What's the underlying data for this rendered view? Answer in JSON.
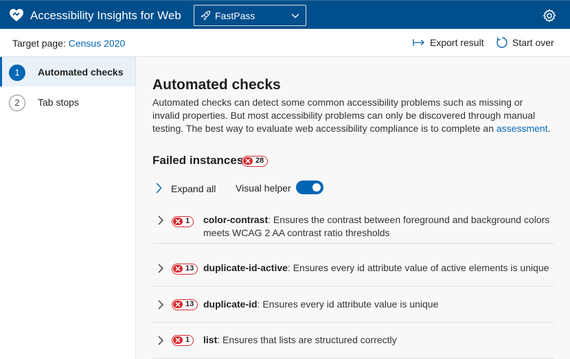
{
  "app": {
    "title": "Accessibility Insights for Web",
    "mode_selected": "FastPass",
    "brand_icon": "heart-icon",
    "settings_icon": "gear-icon"
  },
  "command_bar": {
    "target_label": "Target page: ",
    "target_link": "Census 2020",
    "export_label": "Export result",
    "start_over_label": "Start over"
  },
  "left_nav": {
    "items": [
      {
        "number": "1",
        "label": "Automated checks",
        "active": true
      },
      {
        "number": "2",
        "label": "Tab stops",
        "active": false
      }
    ]
  },
  "main": {
    "heading": "Automated checks",
    "description": "Automated checks can detect some common accessibility problems such as missing or invalid properties. But most accessibility problems can only be discovered through manual testing. The best way to evaluate web accessibility compliance is to complete an ",
    "description_link": "assessment",
    "description_end": ".",
    "failed_heading": "Failed instances",
    "failed_count": "28",
    "expand_all_label": "Expand all",
    "visual_helper_label": "Visual helper",
    "visual_helper_on": true,
    "rules": [
      {
        "count": "1",
        "id": "color-contrast",
        "description": ": Ensures the contrast between foreground and background colors meets WCAG 2 AA contrast ratio thresholds"
      },
      {
        "count": "13",
        "id": "duplicate-id-active",
        "description": ": Ensures every id attribute value of active elements is unique"
      },
      {
        "count": "13",
        "id": "duplicate-id",
        "description": ": Ensures every id attribute value is unique"
      },
      {
        "count": "1",
        "id": "list",
        "description": ": Ensures that lists are structured correctly"
      }
    ]
  },
  "colors": {
    "header_bg": "#004e8c",
    "accent": "#0066b4",
    "failure": "#d6292e"
  }
}
